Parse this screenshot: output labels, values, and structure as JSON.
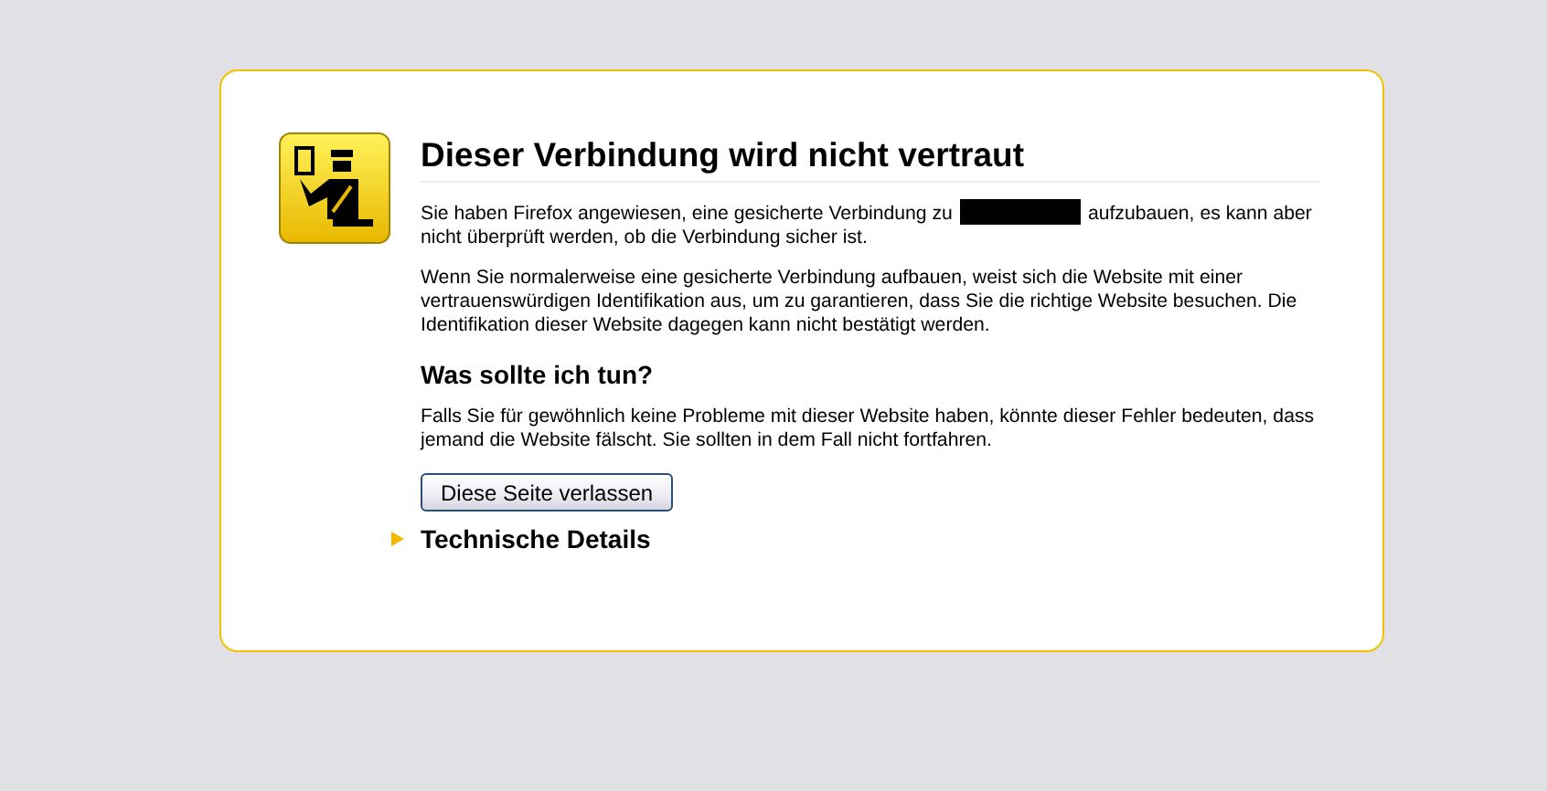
{
  "title": "Dieser Verbindung wird nicht vertraut",
  "intro": {
    "before": "Sie haben Firefox angewiesen, eine gesicherte Verbindung zu",
    "redacted": true,
    "after": "aufzubauen, es kann aber",
    "continued": "nicht überprüft werden, ob die Verbindung sicher ist."
  },
  "explanation": "Wenn Sie normalerweise eine gesicherte Verbindung aufbauen, weist sich die Website mit einer vertrauenswürdigen Identifikation aus, um zu garantieren, dass Sie die richtige Website besuchen. Die Identifikation dieser Website dagegen kann nicht bestätigt werden.",
  "what_to_do": {
    "heading": "Was sollte ich tun?",
    "text": "Falls Sie für gewöhnlich keine Probleme mit dieser Website haben, könnte dieser Fehler bedeuten, dass jemand die Website fälscht. Sie sollten in dem Fall nicht fortfahren.",
    "button": "Diese Seite verlassen"
  },
  "sections": [
    {
      "label": "Technische Details",
      "expanded": false
    }
  ]
}
